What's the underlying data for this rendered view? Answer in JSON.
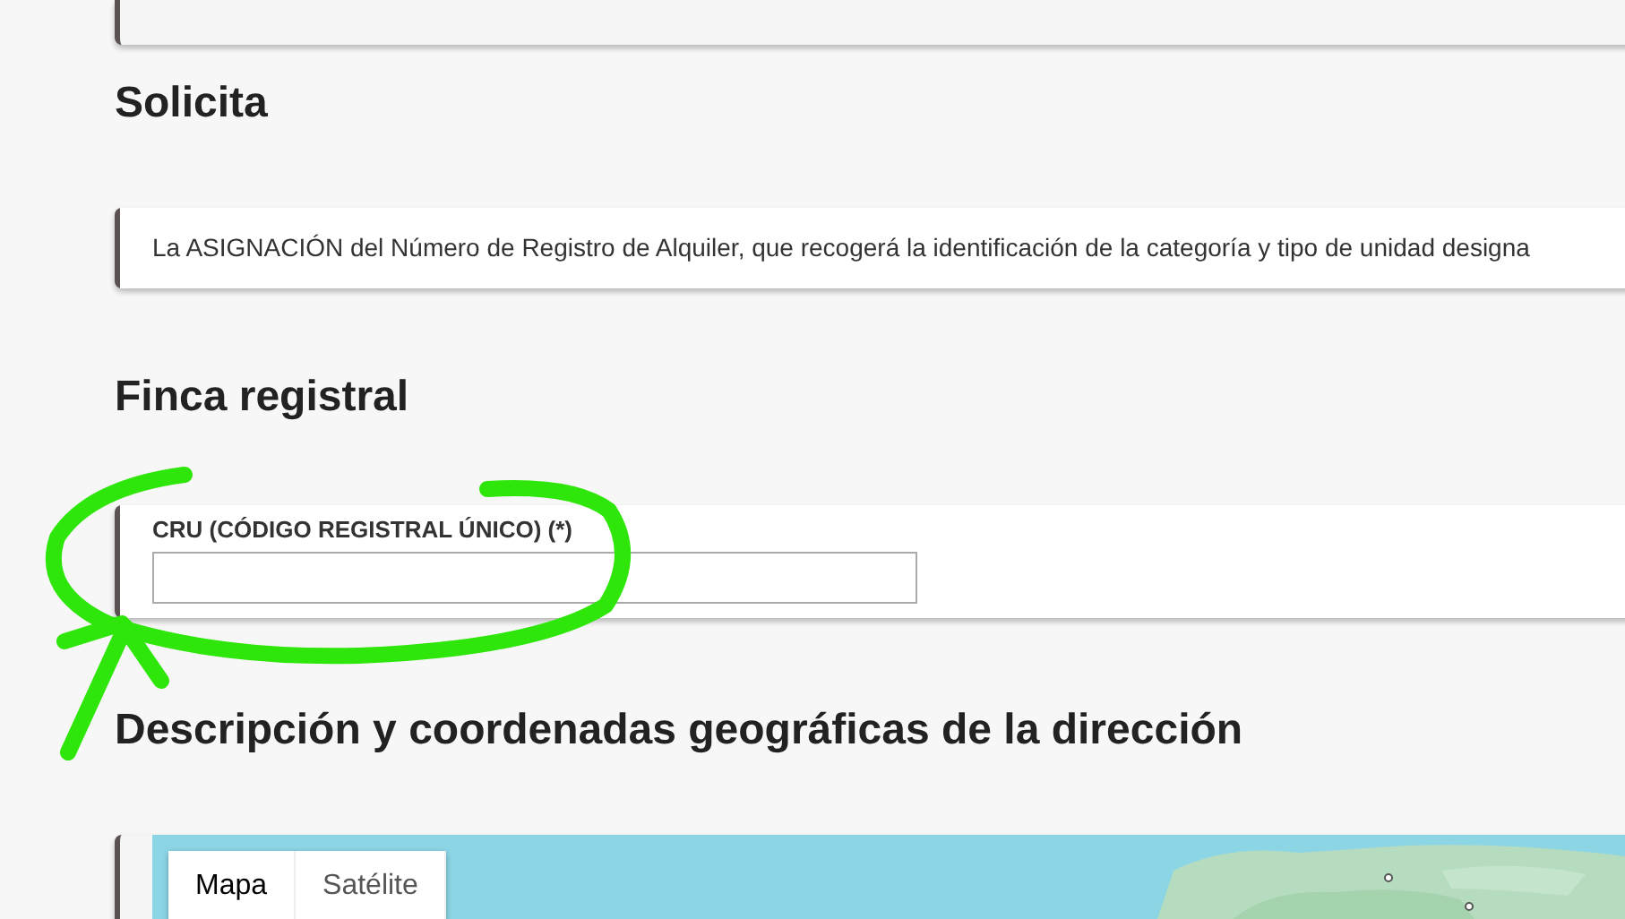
{
  "sections": [
    {
      "kind": "text",
      "heading": "Solicita",
      "text": "La ASIGNACIÓN del Número de Registro de Alquiler, que recogerá la identificación de la categoría y tipo de unidad designa"
    },
    {
      "kind": "field",
      "heading": "Finca registral",
      "label": "CRU (CÓDIGO REGISTRAL ÚNICO) (*)"
    },
    {
      "kind": "map",
      "heading": "Descripción y coordenadas geográficas de la dirección",
      "map_tabs": [
        {
          "label": "Mapa",
          "selected": true
        },
        {
          "label": "Satélite",
          "selected": false
        }
      ]
    }
  ]
}
